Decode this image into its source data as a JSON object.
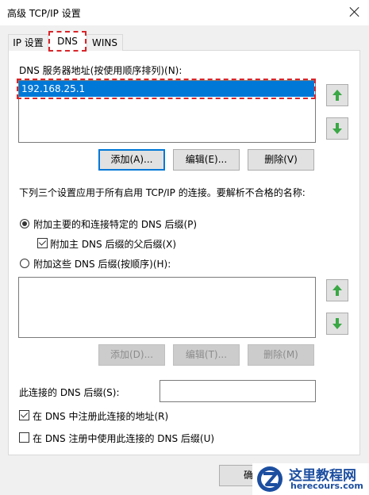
{
  "window": {
    "title": "高级 TCP/IP 设置"
  },
  "tabs": [
    {
      "label": "IP 设置",
      "active": false
    },
    {
      "label": "DNS",
      "active": true
    },
    {
      "label": "WINS",
      "active": false
    }
  ],
  "dns_servers": {
    "label": "DNS 服务器地址(按使用顺序排列)(N):",
    "items": [
      "192.168.25.1"
    ],
    "buttons": {
      "add": "添加(A)...",
      "edit": "编辑(E)...",
      "remove": "删除(V)"
    }
  },
  "description": "下列三个设置应用于所有启用 TCP/IP 的连接。要解析不合格的名称:",
  "suffix_options": {
    "primary": {
      "label": "附加主要的和连接特定的 DNS 后缀(P)",
      "selected": true
    },
    "parent": {
      "label": "附加主 DNS 后缀的父后缀(X)",
      "checked": true
    },
    "these": {
      "label": "附加这些 DNS 后缀(按顺序)(H):",
      "selected": false
    }
  },
  "suffix_buttons": {
    "add": "添加(D)...",
    "edit": "编辑(T)...",
    "remove": "删除(M)"
  },
  "connection_suffix": {
    "label": "此连接的 DNS 后缀(S):",
    "value": ""
  },
  "register": {
    "label": "在 DNS 中注册此连接的地址(R)",
    "checked": true
  },
  "use_suffix": {
    "label": "在 DNS 注册中使用此连接的 DNS 后缀(U)",
    "checked": false
  },
  "footer": {
    "ok_partial": "确"
  },
  "watermark": {
    "line1": "这里教程网",
    "line2": "herecours.com"
  },
  "colors": {
    "selection": "#0078d7",
    "highlight_dash": "#d9252a",
    "arrow_green": "#3aa845",
    "watermark_blue": "#1c4ea0"
  }
}
